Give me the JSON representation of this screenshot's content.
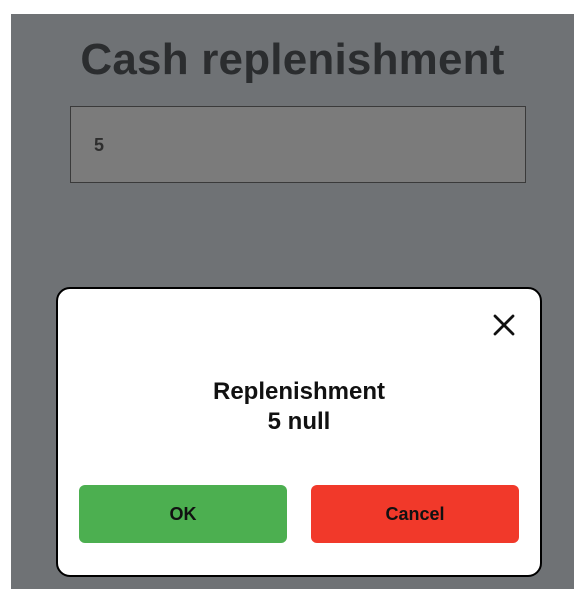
{
  "page": {
    "title": "Cash replenishment"
  },
  "amount_field": {
    "value": "5"
  },
  "dialog": {
    "message_line1": "Replenishment",
    "message_line2": "5 null",
    "ok_label": "OK",
    "cancel_label": "Cancel",
    "close_icon": "close-icon"
  },
  "colors": {
    "background": "#6f7275",
    "ok_button": "#4caf50",
    "cancel_button": "#f1392a",
    "dialog_background": "#ffffff"
  }
}
